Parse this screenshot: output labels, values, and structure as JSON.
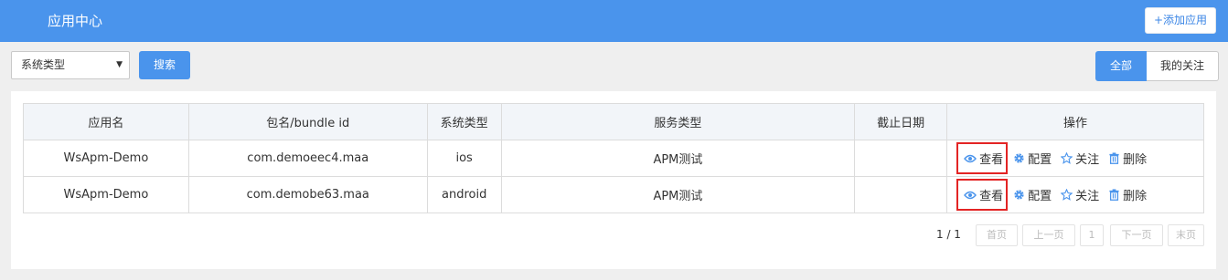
{
  "header": {
    "title": "应用中心",
    "add_button": "+添加应用"
  },
  "toolbar": {
    "select_value": "系统类型",
    "search_button": "搜索"
  },
  "filters": {
    "all": "全部",
    "mine": "我的关注"
  },
  "table": {
    "columns": [
      "应用名",
      "包名/bundle id",
      "系统类型",
      "服务类型",
      "截止日期",
      "操作"
    ],
    "rows": [
      {
        "app_name": "WsApm-Demo",
        "bundle": "com.demoeec4.maa",
        "os": "ios",
        "service": "APM测试",
        "deadline": ""
      },
      {
        "app_name": "WsApm-Demo",
        "bundle": "com.demobe63.maa",
        "os": "android",
        "service": "APM测试",
        "deadline": ""
      }
    ],
    "actions": {
      "view": "查看",
      "config": "配置",
      "follow": "关注",
      "delete": "删除"
    }
  },
  "pagination": {
    "info": "1 / 1",
    "first": "首页",
    "prev": "上一页",
    "current": "1",
    "next": "下一页",
    "last": "末页"
  },
  "colors": {
    "accent": "#4a94ec",
    "highlight": "#e32424"
  }
}
